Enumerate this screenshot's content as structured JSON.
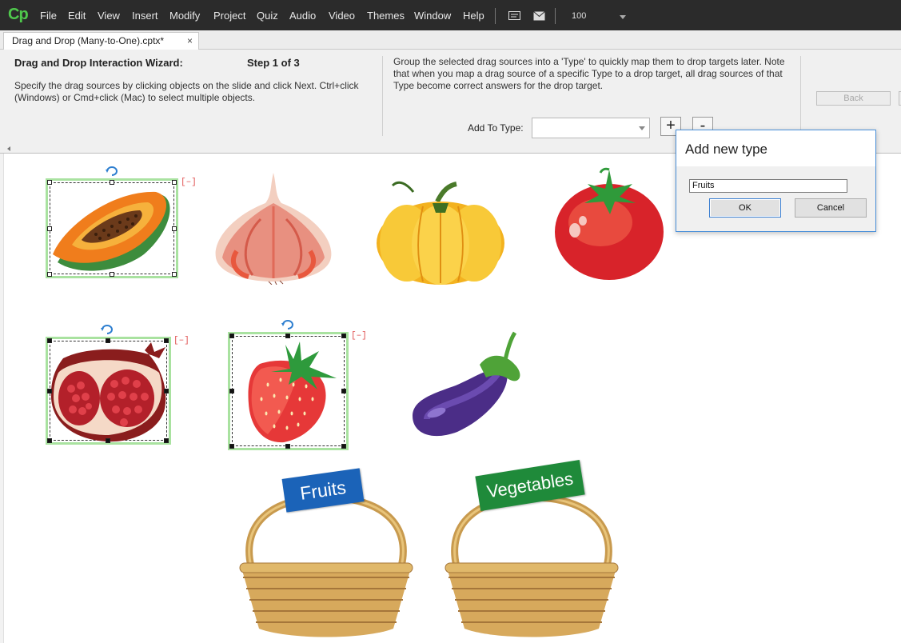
{
  "app": {
    "logo": "Cp",
    "menu": [
      "File",
      "Edit",
      "View",
      "Insert",
      "Modify",
      "Project",
      "Quiz",
      "Audio",
      "Video",
      "Themes",
      "Window",
      "Help"
    ],
    "zoom": "100",
    "accent": "#4fc94c"
  },
  "tabs": {
    "document": "Drag and Drop (Many-to-One).cptx*",
    "close": "×"
  },
  "wizard": {
    "title": "Drag and Drop Interaction Wizard:",
    "step": "Step  1  of 3",
    "description": "Specify the drag sources by clicking objects on the slide and click Next. Ctrl+click (Windows) or Cmd+click (Mac) to select multiple objects.",
    "help": "Group the selected drag sources into a 'Type' to quickly map them to drop targets later. Note that when you map a drag source of a specific Type to a drop target, all drag sources of that Type become correct answers for the drop target.",
    "add_to_type_label": "Add To Type:",
    "add_to_type_value": "",
    "plus": "+",
    "minus": "-",
    "back": "Back"
  },
  "stage": {
    "collapse_mark": "[–]",
    "objects": [
      "papaya",
      "onion",
      "pumpkin",
      "tomato",
      "pomegranate",
      "strawberry",
      "eggplant"
    ],
    "selected": [
      "papaya",
      "pomegranate",
      "strawberry"
    ],
    "baskets": [
      {
        "label": "Fruits",
        "color": "#1b63b8"
      },
      {
        "label": "Vegetables",
        "color": "#1f8a3a"
      }
    ]
  },
  "dialog": {
    "title": "Add new type",
    "value": "Fruits",
    "ok": "OK",
    "cancel": "Cancel"
  }
}
